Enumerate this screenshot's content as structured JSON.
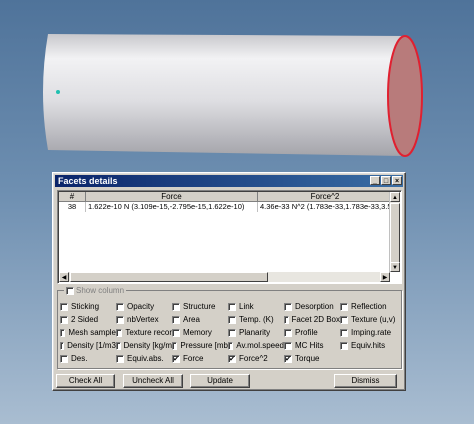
{
  "window": {
    "title": "Facets details",
    "minimize_glyph": "_",
    "maximize_glyph": "□",
    "close_glyph": "×"
  },
  "table": {
    "columns": [
      "#",
      "Force",
      "Force^2"
    ],
    "rows": [
      [
        "38",
        "1.622e-10 N (3.109e-15,-2.795e-15,1.622e-10)",
        "4.36e-33 N^2 (1.783e-33,1.783e-33,3.5"
      ]
    ]
  },
  "show_column": {
    "legend": "Show column",
    "items": [
      {
        "label": "Sticking",
        "checked": false
      },
      {
        "label": "Opacity",
        "checked": false
      },
      {
        "label": "Structure",
        "checked": false
      },
      {
        "label": "Link",
        "checked": false
      },
      {
        "label": "Desorption",
        "checked": false
      },
      {
        "label": "Reflection",
        "checked": false
      },
      {
        "label": "2 Sided",
        "checked": false
      },
      {
        "label": "nbVertex",
        "checked": false
      },
      {
        "label": "Area",
        "checked": false
      },
      {
        "label": "Temp. (K)",
        "checked": false
      },
      {
        "label": "Facet 2D Box",
        "checked": false
      },
      {
        "label": "Texture (u,v)",
        "checked": false
      },
      {
        "label": "Mesh sample",
        "checked": false
      },
      {
        "label": "Texture recor",
        "checked": false
      },
      {
        "label": "Memory",
        "checked": false
      },
      {
        "label": "Planarity",
        "checked": false
      },
      {
        "label": "Profile",
        "checked": false
      },
      {
        "label": "Imping.rate",
        "checked": false
      },
      {
        "label": "Density [1/m3",
        "checked": false
      },
      {
        "label": "Density [kg/m",
        "checked": false
      },
      {
        "label": "Pressure [mb",
        "checked": false
      },
      {
        "label": "Av.mol.speed",
        "checked": false
      },
      {
        "label": "MC Hits",
        "checked": false
      },
      {
        "label": "Equiv.hits",
        "checked": false
      },
      {
        "label": "Des.",
        "checked": false
      },
      {
        "label": "Equiv.abs.",
        "checked": false
      },
      {
        "label": "Force",
        "checked": true
      },
      {
        "label": "Force^2",
        "checked": true
      },
      {
        "label": "Torque",
        "checked": true
      }
    ]
  },
  "buttons": {
    "check_all": "Check All",
    "uncheck_all": "Uncheck All",
    "update": "Update",
    "dismiss": "Dismiss"
  },
  "colors": {
    "background": "#6e8fb1",
    "title_bar": "#0a246a",
    "highlighted_facet": "#e02030"
  }
}
